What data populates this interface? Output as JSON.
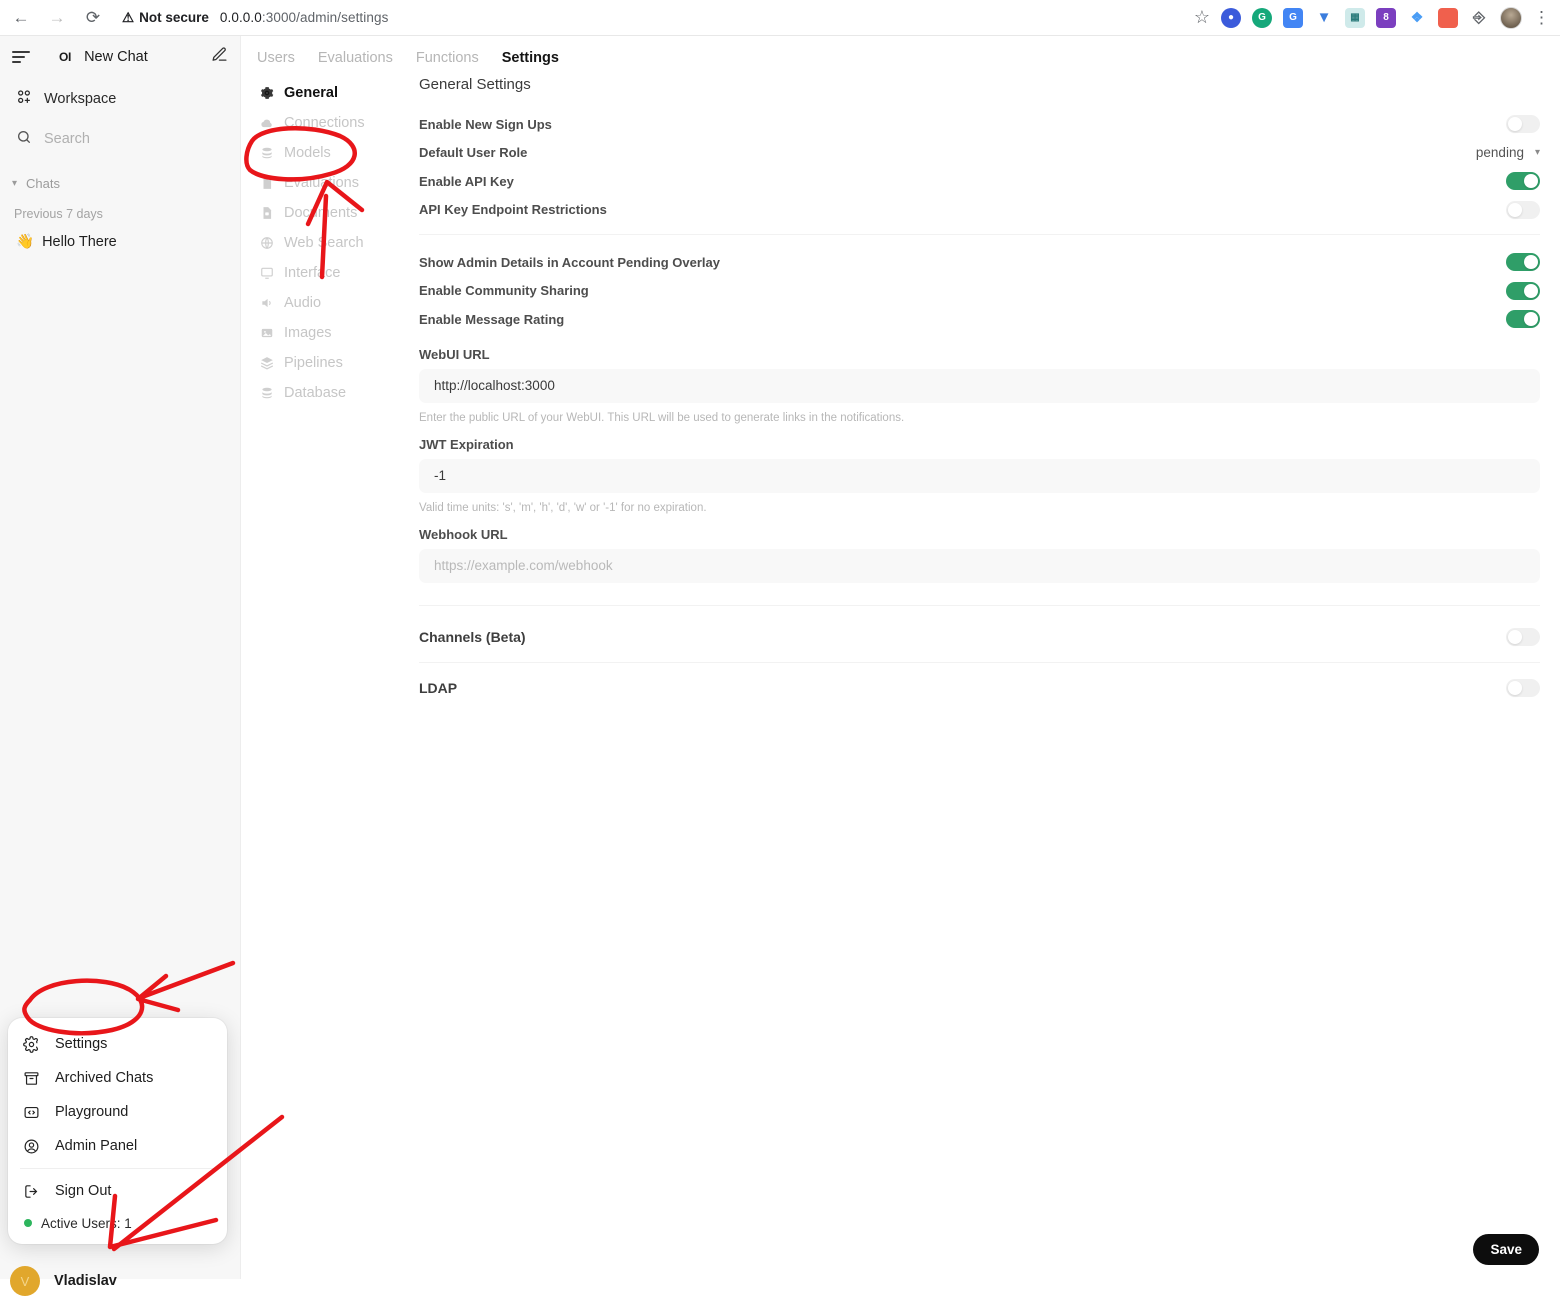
{
  "browser": {
    "back_icon": "arrow-left-icon",
    "forward_icon": "arrow-right-icon",
    "reload_icon": "reload-icon",
    "security_label": "Not secure",
    "security_icon": "warning-triangle-icon",
    "url_host": "0.0.0.0",
    "url_path": ":3000/admin/settings",
    "url_full": "0.0.0.0:3000/admin/settings",
    "bookmark_icon": "star-icon",
    "extensions": [
      {
        "name": "extension-icon-blue-circle",
        "glyph": "●",
        "color": "#3b5bdb",
        "label": ""
      },
      {
        "name": "grammarly-icon",
        "glyph": "G",
        "color": "#15a87a",
        "label": "G"
      },
      {
        "name": "google-translate-icon",
        "glyph": "G",
        "color": "#4285f4",
        "label": "G"
      },
      {
        "name": "bitwarden-icon",
        "glyph": "⬇",
        "color": "#3b7ddd",
        "label": ""
      },
      {
        "name": "puzzle-teal-icon",
        "glyph": "⊞",
        "color": "#3aa6a6",
        "label": ""
      },
      {
        "name": "badge-8-icon",
        "glyph": "8",
        "color": "#7b3fbf",
        "label": "8"
      },
      {
        "name": "developer-icon",
        "glyph": "◆",
        "color": "#4a9df5",
        "label": ""
      },
      {
        "name": "colorpicker-icon",
        "glyph": "■",
        "color": "#f0604d",
        "label": ""
      },
      {
        "name": "extensions-puzzle-icon",
        "glyph": "⬚",
        "color": "#5f6368",
        "label": ""
      }
    ],
    "profile_icon": "chrome-profile-avatar",
    "menu_icon": "kebab-menu-icon"
  },
  "sidebar": {
    "hamburger_icon": "hamburger-menu-icon",
    "logo_text": "OI",
    "new_chat_label": "New Chat",
    "compose_icon": "compose-pencil-icon",
    "workspace_label": "Workspace",
    "workspace_icon": "workspace-grid-icon",
    "search_placeholder": "Search",
    "search_icon": "search-icon",
    "chats_label": "Chats",
    "chats_chevron": "chevron-down-icon",
    "time_group_label": "Previous 7 days",
    "chat_items": [
      {
        "emoji": "👋",
        "title": "Hello There"
      }
    ]
  },
  "user_menu": {
    "items": [
      {
        "label": "Settings",
        "icon": "gear-icon"
      },
      {
        "label": "Archived Chats",
        "icon": "archive-box-icon"
      },
      {
        "label": "Playground",
        "icon": "code-brackets-icon"
      },
      {
        "label": "Admin Panel",
        "icon": "user-circle-icon"
      },
      {
        "label": "Sign Out",
        "icon": "sign-out-icon"
      }
    ],
    "active_users_label": "Active Users: 1",
    "active_dot_color": "#2db55d"
  },
  "user": {
    "avatar_initial": "V",
    "avatar_color": "#e1a72c",
    "name": "Vladislav"
  },
  "admin": {
    "tabs": [
      {
        "label": "Users",
        "active": false
      },
      {
        "label": "Evaluations",
        "active": false
      },
      {
        "label": "Functions",
        "active": false
      },
      {
        "label": "Settings",
        "active": true
      }
    ],
    "nav_items": [
      {
        "label": "General",
        "icon": "gear-icon",
        "active": true
      },
      {
        "label": "Connections",
        "icon": "cloud-icon",
        "active": false
      },
      {
        "label": "Models",
        "icon": "database-stack-icon",
        "active": false
      },
      {
        "label": "Evaluations",
        "icon": "document-icon",
        "active": false
      },
      {
        "label": "Documents",
        "icon": "document-lock-icon",
        "active": false
      },
      {
        "label": "Web Search",
        "icon": "globe-icon",
        "active": false
      },
      {
        "label": "Interface",
        "icon": "monitor-icon",
        "active": false
      },
      {
        "label": "Audio",
        "icon": "speaker-icon",
        "active": false
      },
      {
        "label": "Images",
        "icon": "image-icon",
        "active": false
      },
      {
        "label": "Pipelines",
        "icon": "layers-icon",
        "active": false
      },
      {
        "label": "Database",
        "icon": "database-icon",
        "active": false
      }
    ]
  },
  "settings": {
    "section_title": "General Settings",
    "toggles_group_1": [
      {
        "label": "Enable New Sign Ups",
        "on": false
      },
      {
        "label": "Enable API Key",
        "on": true
      },
      {
        "label": "API Key Endpoint Restrictions",
        "on": false
      }
    ],
    "default_user_role": {
      "label": "Default User Role",
      "value": "pending",
      "chevron": "chevron-down-icon"
    },
    "toggles_group_2": [
      {
        "label": "Show Admin Details in Account Pending Overlay",
        "on": true
      },
      {
        "label": "Enable Community Sharing",
        "on": true
      },
      {
        "label": "Enable Message Rating",
        "on": true
      }
    ],
    "webui_url": {
      "label": "WebUI URL",
      "value": "http://localhost:3000",
      "help": "Enter the public URL of your WebUI. This URL will be used to generate links in the notifications."
    },
    "jwt_expiration": {
      "label": "JWT Expiration",
      "value": "-1",
      "help": "Valid time units: 's', 'm', 'h', 'd', 'w' or '-1' for no expiration."
    },
    "webhook_url": {
      "label": "Webhook URL",
      "value": "",
      "placeholder": "https://example.com/webhook"
    },
    "channels": {
      "label": "Channels (Beta)",
      "on": false
    },
    "ldap": {
      "label": "LDAP",
      "on": false
    },
    "save_label": "Save",
    "accent_green": "#2f9e68",
    "annotation_color": "#e8161a"
  }
}
